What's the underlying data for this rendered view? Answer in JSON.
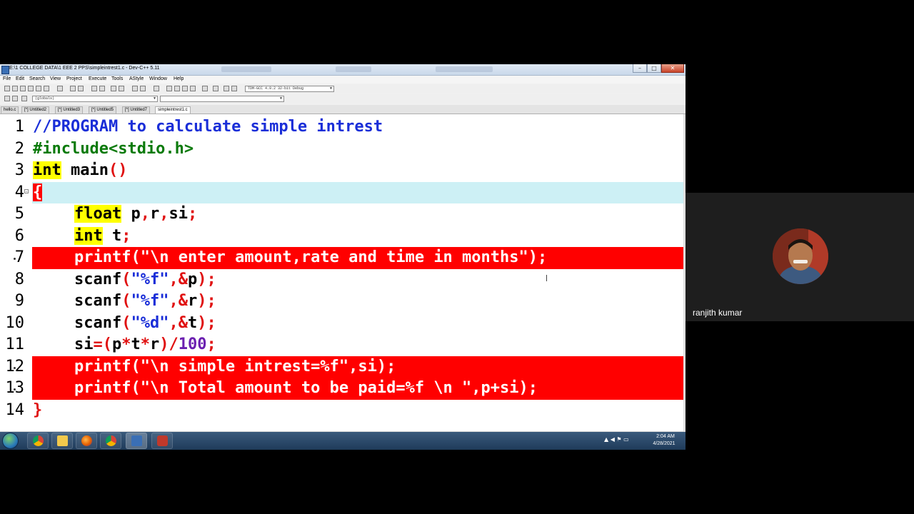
{
  "window": {
    "title": "E:\\1 COLLEGE DATA\\1 EEE 2  PPS\\simpleintrest1.c - Dev-C++ 5.11",
    "menu": [
      "File",
      "Edit",
      "Search",
      "View",
      "Project",
      "Execute",
      "Tools",
      "AStyle",
      "Window",
      "Help"
    ],
    "compiler_select": "TDM-GCC 4.9.2 32-bit Debug",
    "scope_select": "(globals)",
    "tabs": [
      "hello.c",
      "[*] Untitled2",
      "[*] Untitled3",
      "[*] Untitled5",
      "[*] Untitled7",
      "simpleintrest1.c"
    ],
    "active_tab": "simpleintrest1.c",
    "controls": {
      "minimize": "–",
      "maximize": "□",
      "close": "✕"
    }
  },
  "editor": {
    "line_numbers": [
      "1",
      "2",
      "3",
      "4",
      "5",
      "6",
      "7",
      "8",
      "9",
      "10",
      "11",
      "12",
      "13",
      "14"
    ],
    "lines": {
      "l1": "//PROGRAM to calculate simple intrest",
      "l2": "#include<stdio.h>",
      "l3_kw": "int",
      "l3_rest": " main",
      "l3_paren": "()",
      "l4": "{",
      "l5_kw": "float",
      "l5_rest": " p",
      "l5_c1": ",",
      "l5_r": "r",
      "l5_c2": ",",
      "l5_si": "si",
      "l5_semi": ";",
      "l6_kw": "int",
      "l6_rest": " t",
      "l6_semi": ";",
      "l7": "printf(\"\\n enter amount,rate and time in months\");",
      "l8_a": "scanf",
      "l8_b": "(",
      "l8_c": "\"%f\"",
      "l8_d": ",&",
      "l8_e": "p",
      "l8_f": ");",
      "l9_c": "\"%f\"",
      "l9_e": "r",
      "l10_c": "\"%d\"",
      "l10_e": "t",
      "l11_a": "si",
      "l11_b": "=(",
      "l11_c": "p",
      "l11_d": "*",
      "l11_e": "t",
      "l11_f": "*",
      "l11_g": "r",
      "l11_h": ")/",
      "l11_i": "100",
      "l11_j": ";",
      "l12": "printf(\"\\n simple intrest=%f\",si);",
      "l13": "printf(\"\\n Total amount to be paid=%f \\n \",p+si);",
      "l14": "}"
    },
    "highlighted_lines": [
      "7",
      "12",
      "13"
    ],
    "current_line": "4"
  },
  "taskbar": {
    "apps": [
      "start",
      "chrome",
      "explorer",
      "firefox",
      "chrome",
      "devcpp",
      "screen-recorder"
    ],
    "tray": "▲  ◀  ⚑  ▭",
    "time": "2:04 AM",
    "date": "4/28/2021"
  },
  "participant": {
    "name": "ranjith kumar"
  },
  "colors": {
    "highlight_red": "#ff0000",
    "current_line": "#cdf0f5",
    "keyword_bg": "#ffff00",
    "comment": "#1a2ed8",
    "preprocessor": "#0a7a0a"
  }
}
